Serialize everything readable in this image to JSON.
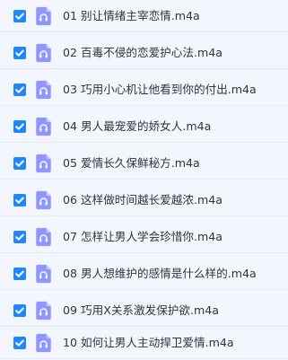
{
  "files": [
    {
      "checked": true,
      "icon": "audio-file-icon",
      "name": "01 别让情绪主宰恋情.m4a"
    },
    {
      "checked": true,
      "icon": "audio-file-icon",
      "name": "02 百毒不侵的恋爱护心法.m4a"
    },
    {
      "checked": true,
      "icon": "audio-file-icon",
      "name": "03 巧用小心机让他看到你的付出.m4a"
    },
    {
      "checked": true,
      "icon": "audio-file-icon",
      "name": "04 男人最宠爱的娇女人.m4a"
    },
    {
      "checked": true,
      "icon": "audio-file-icon",
      "name": "05 爱情长久保鲜秘方.m4a"
    },
    {
      "checked": true,
      "icon": "audio-file-icon",
      "name": "06 这样做时间越长爱越浓.m4a"
    },
    {
      "checked": true,
      "icon": "audio-file-icon",
      "name": "07 怎样让男人学会珍惜你.m4a"
    },
    {
      "checked": true,
      "icon": "audio-file-icon",
      "name": "08 男人想维护的感情是什么样的.m4a"
    },
    {
      "checked": true,
      "icon": "audio-file-icon",
      "name": "09 巧用X关系激发保护欲.m4a"
    },
    {
      "checked": true,
      "icon": "audio-file-icon",
      "name": "10 如何让男人主动捍卫爱情.m4a"
    }
  ],
  "colors": {
    "checkbox": "#1f86ff",
    "audio_icon": "#8f96ff",
    "text": "#2f3440",
    "background": "#f3f7fd"
  }
}
